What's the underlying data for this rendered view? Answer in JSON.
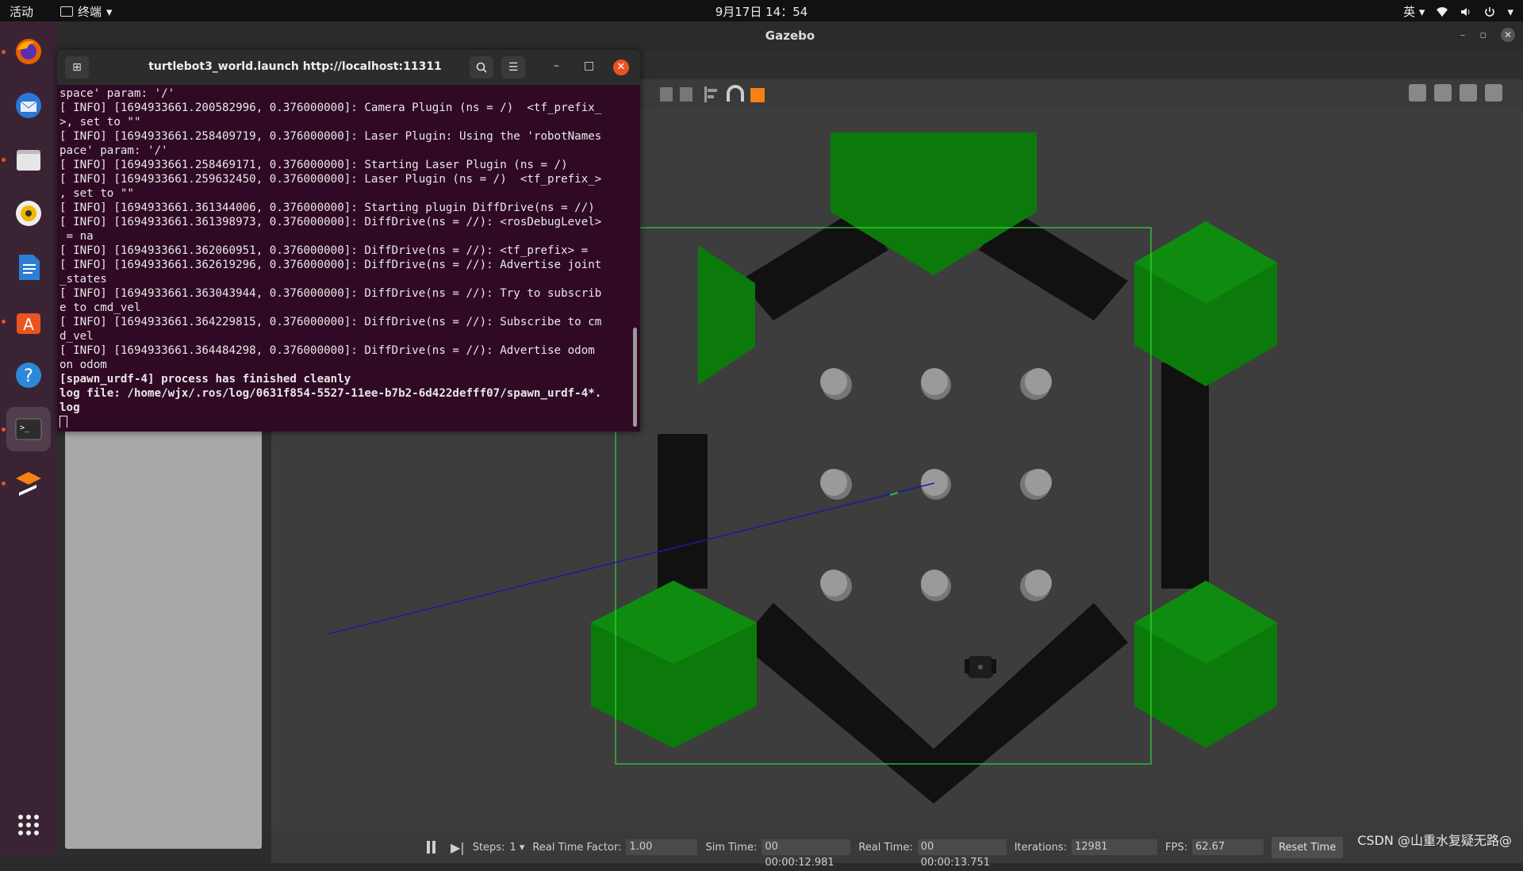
{
  "topbar": {
    "activities": "活动",
    "app_name": "终端",
    "clock": "9月17日  14：54",
    "input_method": "英"
  },
  "dock": {
    "items": [
      {
        "name": "firefox",
        "running": true
      },
      {
        "name": "thunderbird",
        "running": false
      },
      {
        "name": "files",
        "running": true
      },
      {
        "name": "rhythmbox",
        "running": false
      },
      {
        "name": "libreoffice-writer",
        "running": false
      },
      {
        "name": "ubuntu-software",
        "running": true
      },
      {
        "name": "help",
        "running": false
      },
      {
        "name": "terminal",
        "running": true,
        "active": true
      },
      {
        "name": "gazebo",
        "running": true
      }
    ],
    "show_apps_label": "show-apps"
  },
  "gazebo": {
    "title": "Gazebo",
    "bottombar": {
      "steps_label": "Steps:",
      "steps_value": "1",
      "rtf_label": "Real Time Factor:",
      "rtf_value": "1.00",
      "sim_time_label": "Sim Time:",
      "sim_time_value": "00 00:00:12.981",
      "real_time_label": "Real Time:",
      "real_time_value": "00 00:00:13.751",
      "iterations_label": "Iterations:",
      "iterations_value": "12981",
      "fps_label": "FPS:",
      "fps_value": "62.67",
      "reset_label": "Reset Time"
    },
    "watermark": "CSDN @山重水复疑无路@"
  },
  "terminal": {
    "title": "turtlebot3_world.launch http://localhost:11311",
    "lines": [
      "space' param: '/'",
      "[ INFO] [1694933661.200582996, 0.376000000]: Camera Plugin (ns = /)  <tf_prefix_",
      ">, set to \"\"",
      "[ INFO] [1694933661.258409719, 0.376000000]: Laser Plugin: Using the 'robotNames",
      "pace' param: '/'",
      "[ INFO] [1694933661.258469171, 0.376000000]: Starting Laser Plugin (ns = /)",
      "[ INFO] [1694933661.259632450, 0.376000000]: Laser Plugin (ns = /)  <tf_prefix_>",
      ", set to \"\"",
      "[ INFO] [1694933661.361344006, 0.376000000]: Starting plugin DiffDrive(ns = //)",
      "[ INFO] [1694933661.361398973, 0.376000000]: DiffDrive(ns = //): <rosDebugLevel>",
      " = na",
      "[ INFO] [1694933661.362060951, 0.376000000]: DiffDrive(ns = //): <tf_prefix> =",
      "[ INFO] [1694933661.362619296, 0.376000000]: DiffDrive(ns = //): Advertise joint",
      "_states",
      "[ INFO] [1694933661.363043944, 0.376000000]: DiffDrive(ns = //): Try to subscrib",
      "e to cmd_vel",
      "[ INFO] [1694933661.364229815, 0.376000000]: DiffDrive(ns = //): Subscribe to cm",
      "d_vel",
      "[ INFO] [1694933661.364484298, 0.376000000]: DiffDrive(ns = //): Advertise odom",
      "on odom"
    ],
    "bold_lines": [
      "[spawn_urdf-4] process has finished cleanly",
      "log file: /home/wjx/.ros/log/0631f854-5527-11ee-b7b2-6d422defff07/spawn_urdf-4*.",
      "log"
    ]
  },
  "colors": {
    "terminal_bg": "#300a24",
    "hex_green": "#0b7a0b",
    "wall": "#111111",
    "close_orange": "#e95420",
    "laser_blue": "#1a1aa8"
  }
}
